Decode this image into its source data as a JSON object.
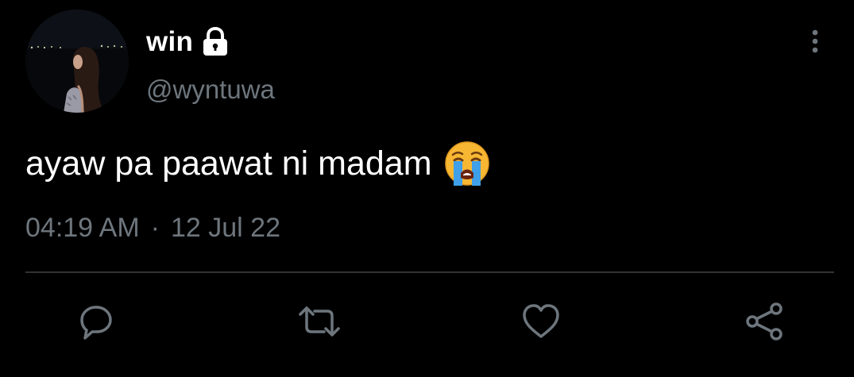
{
  "user": {
    "display_name": "win",
    "handle": "@wyntuwa",
    "avatar_icon": "profile-photo",
    "protected_icon": "lock-icon"
  },
  "tweet": {
    "text": "ayaw pa paawat ni madam",
    "emoji_icon": "loudly-crying-face-emoji"
  },
  "meta": {
    "time": "04:19 AM",
    "separator": "·",
    "date": "12 Jul 22"
  },
  "actions": [
    {
      "icon": "reply-icon"
    },
    {
      "icon": "retweet-icon"
    },
    {
      "icon": "like-icon"
    },
    {
      "icon": "share-icon"
    }
  ],
  "menu": {
    "icon": "more-options-icon"
  },
  "colors": {
    "background": "#000000",
    "primary_text": "#ffffff",
    "secondary_text": "#6e767d",
    "divider": "#2f3336",
    "icon": "#6e767d"
  }
}
